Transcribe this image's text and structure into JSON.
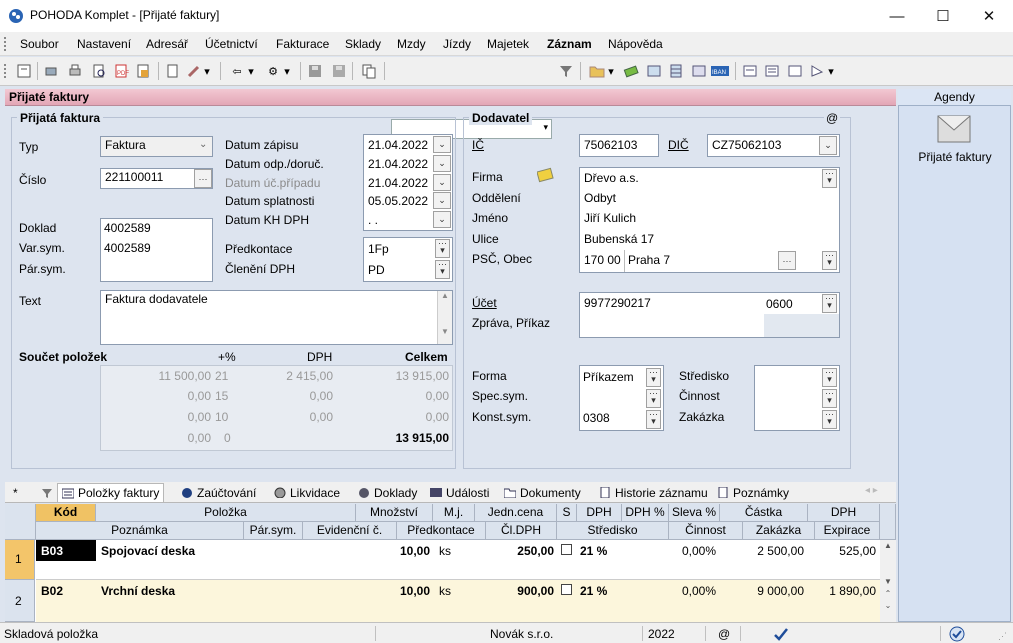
{
  "window": {
    "title": "POHODA Komplet - [Přijaté faktury]",
    "min": "—",
    "max": "☐",
    "close": "✕"
  },
  "menu": [
    "Soubor",
    "Nastavení",
    "Adresář",
    "Účetnictví",
    "Fakturace",
    "Sklady",
    "Mzdy",
    "Jízdy",
    "Majetek",
    "Záznam",
    "Nápověda"
  ],
  "agenda": {
    "title": "Přijaté faktury"
  },
  "agendy": {
    "header": "Agendy",
    "item": "Přijaté faktury"
  },
  "invoice": {
    "section": "Přijatá faktura",
    "typ_label": "Typ",
    "typ": "Faktura",
    "cislo_label": "Číslo",
    "cislo": "221100011",
    "doklad_label": "Doklad",
    "doklad": "4002589",
    "varsym_label": "Var.sym.",
    "varsym": "4002589",
    "parsym_label": "Pár.sym.",
    "parsym": "",
    "text_label": "Text",
    "text": "Faktura dodavatele",
    "datum_zapisu_label": "Datum zápisu",
    "datum_zapisu": "21.04.2022",
    "datum_odp_label": "Datum odp./doruč.",
    "datum_odp": "21.04.2022",
    "datum_uc_label": "Datum úč.případu",
    "datum_uc": "21.04.2022",
    "datum_splat_label": "Datum splatnosti",
    "datum_splat": "05.05.2022",
    "datum_kh_label": "Datum KH DPH",
    "datum_kh": " .  .",
    "predkontace_label": "Předkontace",
    "predkontace": "1Fp",
    "cleneni_label": "Členění DPH",
    "cleneni": "PD"
  },
  "summary": {
    "title": "Součet položek",
    "h_pct": "+%",
    "h_dph": "DPH",
    "h_celkem": "Celkem",
    "rows": [
      {
        "base": "11 500,00",
        "pct": "21",
        "dph": "2 415,00",
        "total": "13 915,00"
      },
      {
        "base": "0,00",
        "pct": "15",
        "dph": "0,00",
        "total": "0,00"
      },
      {
        "base": "0,00",
        "pct": "10",
        "dph": "0,00",
        "total": "0,00"
      },
      {
        "base": "0,00",
        "pct": "0",
        "dph": "",
        "total": "13 915,00"
      }
    ]
  },
  "supplier": {
    "section": "Dodavatel",
    "at": "@",
    "ic_label": "IČ",
    "ic": "75062103",
    "dic_label": "DIČ",
    "dic": "CZ75062103",
    "firma_label": "Firma",
    "firma": "Dřevo a.s.",
    "oddeleni_label": "Oddělení",
    "oddeleni": "Odbyt",
    "jmeno_label": "Jméno",
    "jmeno": "Jiří Kulich",
    "ulice_label": "Ulice",
    "ulice": "Bubenská 17",
    "psc_label": "PSČ, Obec",
    "psc": "170 00",
    "obec": "Praha 7",
    "ucet_label": "Účet",
    "ucet": "9977290217",
    "banka": "0600",
    "zprava_label": "Zpráva, Příkaz",
    "forma_label": "Forma",
    "forma": "Příkazem",
    "spec_label": "Spec.sym.",
    "spec": "",
    "konst_label": "Konst.sym.",
    "konst": "0308",
    "stredisko_label": "Středisko",
    "cinnost_label": "Činnost",
    "zakazka_label": "Zakázka"
  },
  "tabs": [
    "*",
    "Položky faktury",
    "Zaúčtování",
    "Likvidace",
    "Doklady",
    "Události",
    "Dokumenty",
    "Historie záznamu",
    "Poznámky"
  ],
  "grid": {
    "h1": [
      "Kód",
      "Položka",
      "Množství",
      "M.j.",
      "Jedn.cena",
      "S",
      "DPH",
      "DPH %",
      "Sleva %",
      "Částka",
      "DPH"
    ],
    "h2": [
      "Poznámka",
      "Pár.sym.",
      "Evidenční č.",
      "Předkontace",
      "Čl.DPH",
      "Středisko",
      "Činnost",
      "Zakázka",
      "Expirace"
    ],
    "rows": [
      {
        "n": "1",
        "kod": "B03",
        "polozka": "Spojovací deska",
        "mnozstvi": "10,00",
        "mj": "ks",
        "cena": "250,00",
        "dph": "21 %",
        "sleva": "0,00%",
        "castka": "2 500,00",
        "dphval": "525,00"
      },
      {
        "n": "2",
        "kod": "B02",
        "polozka": "Vrchní deska",
        "mnozstvi": "10,00",
        "mj": "ks",
        "cena": "900,00",
        "dph": "21 %",
        "sleva": "0,00%",
        "castka": "9 000,00",
        "dphval": "1 890,00"
      }
    ]
  },
  "status": {
    "left": "Skladová položka",
    "company": "Novák s.r.o.",
    "year": "2022",
    "at": "@"
  }
}
